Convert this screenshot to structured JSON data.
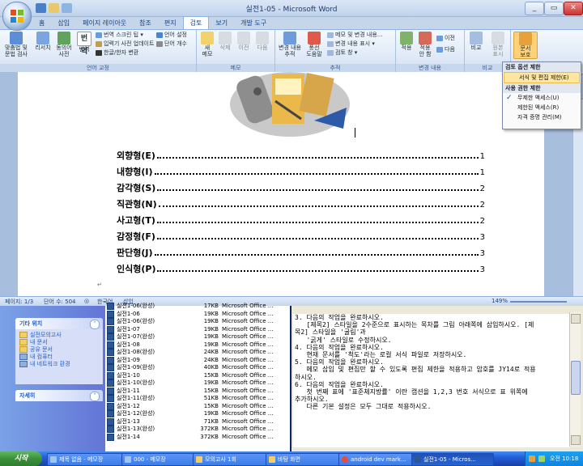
{
  "word": {
    "window_title": "실전1-05 - Microsoft Word",
    "tabs": [
      "홈",
      "삽입",
      "페이지 레이아웃",
      "참조",
      "편지",
      "검토",
      "보기",
      "개발 도구"
    ],
    "active_tab": "검토",
    "ribbon": {
      "proofing": {
        "label": "언어 교정",
        "spell_label": "맞춤법 및\n문법 검사",
        "research_label": "리서치",
        "thesaurus_label": "동의어\n사전",
        "translate_label": "번역",
        "translate_tip_label": "번역 스크린 팁",
        "setlang_label": "언어 설정",
        "update_ime_label": "입력기 사전 업데이트",
        "wordcount_label": "단어 개수",
        "hanja_label": "한글/한자 변환"
      },
      "comments": {
        "label": "메모",
        "new_label": "새\n메모",
        "delete_label": "삭제",
        "prev_label": "이전",
        "next_label": "다음"
      },
      "tracking": {
        "label": "추적",
        "track_label": "변경 내용\n추적",
        "balloon_label": "풍선\n도움말",
        "display_label": "메모 및 변경 내용...",
        "show_markup_label": "변경 내용 표시",
        "reviewing_pane_label": "검토 창"
      },
      "changes": {
        "label": "변경 내용",
        "accept_label": "적용",
        "reject_label": "적용\n안 함",
        "prev_label": "이전",
        "next_label": "다음"
      },
      "compare": {
        "label": "비교",
        "compare_label": "비교",
        "show_source_label": "원본\n표시"
      },
      "protect": {
        "label": "보호",
        "protect_doc_label": "문서\n보호"
      }
    },
    "dropdown": {
      "header1": "검토 옵션 제한",
      "item1": "서식 및 편집 제한(E)",
      "header2": "사용 권한 제한",
      "item2": "무제한 액세스(U)",
      "item3": "제한된 액세스(R)",
      "item4": "자격 증명 관리(M)"
    },
    "toc": [
      {
        "label": "외향형(E)",
        "page": "1"
      },
      {
        "label": "내향형(I)",
        "page": "1"
      },
      {
        "label": "감각형(S)",
        "page": "2"
      },
      {
        "label": "직관형(N)",
        "page": "2"
      },
      {
        "label": "사고형(T)",
        "page": "2"
      },
      {
        "label": "감정형(F)",
        "page": "3"
      },
      {
        "label": "판단형(J)",
        "page": "3"
      },
      {
        "label": "인식형(P)",
        "page": "3"
      }
    ],
    "status": {
      "page": "페이지: 1/3",
      "words": "단어 수: 504",
      "language": "한국어",
      "insert": "삽입",
      "zoom": "149%"
    }
  },
  "explorer": {
    "other_places": {
      "title": "기타 위치",
      "items": [
        "실전모의고사",
        "내 문서",
        "공유 문서",
        "내 컴퓨터",
        "내 네트워크 환경"
      ]
    },
    "details": {
      "title": "자세히"
    },
    "files": [
      {
        "name": "실전1-06(완성)",
        "size": "17KB",
        "type": "Microsoft Office ..."
      },
      {
        "name": "실전1-06",
        "size": "19KB",
        "type": "Microsoft Office ..."
      },
      {
        "name": "실전1-06(완성)",
        "size": "19KB",
        "type": "Microsoft Office ..."
      },
      {
        "name": "실전1-07",
        "size": "19KB",
        "type": "Microsoft Office ..."
      },
      {
        "name": "실전1-07(완성)",
        "size": "19KB",
        "type": "Microsoft Office ..."
      },
      {
        "name": "실전1-08",
        "size": "19KB",
        "type": "Microsoft Office ..."
      },
      {
        "name": "실전1-08(완성)",
        "size": "24KB",
        "type": "Microsoft Office ..."
      },
      {
        "name": "실전1-09",
        "size": "24KB",
        "type": "Microsoft Office ..."
      },
      {
        "name": "실전1-09(완성)",
        "size": "40KB",
        "type": "Microsoft Office ..."
      },
      {
        "name": "실전1-10",
        "size": "15KB",
        "type": "Microsoft Office ..."
      },
      {
        "name": "실전1-10(완성)",
        "size": "19KB",
        "type": "Microsoft Office ..."
      },
      {
        "name": "실전1-11",
        "size": "15KB",
        "type": "Microsoft Office ..."
      },
      {
        "name": "실전1-11(완성)",
        "size": "51KB",
        "type": "Microsoft Office ..."
      },
      {
        "name": "실전1-12",
        "size": "15KB",
        "type": "Microsoft Office ..."
      },
      {
        "name": "실전1-12(완성)",
        "size": "19KB",
        "type": "Microsoft Office ..."
      },
      {
        "name": "실전1-13",
        "size": "71KB",
        "type": "Microsoft Office ..."
      },
      {
        "name": "실전1-13(완성)",
        "size": "372KB",
        "type": "Microsoft Office ..."
      },
      {
        "name": "실전1-14",
        "size": "372KB",
        "type": "Microsoft Office ..."
      }
    ]
  },
  "notepad": {
    "lines": [
      "3. 다음의 작업을 완료하시오.",
      "   [제목2] 스타일을 2수준으로 표시하는 목차를 그림 아래쪽에 삽입하시오. [제",
      "목2] 스타일을 '굴림'과",
      "   '굵게' 스타일로 수정하시오.",
      "",
      "4. 다음의 작업을 완료하시오.",
      "   현재 문서를 '척도'라는 로컬 서식 파일로 저장하시오.",
      "",
      "5. 다음의 작업을 완료하시오.",
      "   메모 삽입 및 편집만 할 수 있도록 편집 제한을 적용하고 암호를 JY14로 적용",
      "하시오.",
      "",
      "6. 다음의 작업을 완료하시오.",
      "   첫 번째 표에 '표준체지방률' 이란 캡션을 1,2,3 번호 서식으로 표 위쪽에",
      "추가하시오.",
      "   다른 기본 설정은 모두 그대로 적용하시오."
    ]
  },
  "taskbar": {
    "start_label": "시작",
    "tasks": [
      "제목 없음 - 메모장",
      "000 - 메모장",
      "모의고사 1회",
      "바탕 화면",
      "android dev mark...",
      "실전1-05 - Micros..."
    ],
    "clock": "오전 10:18"
  },
  "colors": {
    "ribbon_blue": "#c5d5ea",
    "selection_highlight": "#ffe7a2",
    "xp_taskbar": "#245edb",
    "xp_start_green": "#3c8f3c"
  }
}
